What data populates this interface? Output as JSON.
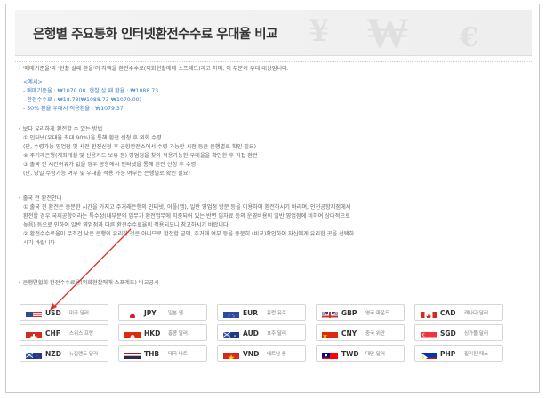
{
  "header": {
    "title": "은행별 주요통화 인터넷환전수수료 우대율 비교"
  },
  "intro": {
    "line1": "'매매기준율'과 '현찰 살때 환율'의 차액을 환전수수료(외화현찰매매 스프레드)라고 하며, 이 부분이 우대 대상입니다.",
    "example_label": "<예시>",
    "ex1": "- 매매기준율 : ₩1070.00, 현찰 살 때 환율 : ₩1088.73",
    "ex2": "- 환전수수료 : ₩18.73(₩1088.73-₩1070.00)",
    "ex3": "- 50% 환율 우대시 적용환율 : ₩1079.37"
  },
  "method": {
    "title": "보다 유리하게 환전할 수 있는 방법",
    "l1": "① 인터넷(우대율 최대 90%)을 통해 환전 신청 후 외화 수령",
    "l2": "(단, 수령가능 영업점 및 사전 환전신청 후 공항환전소에서 수령 가능한 시점 등은 은행별로 확인 필요)",
    "l3": "② 주거래은행(계좌개설 및 신용카드 보유 등) 영업점을 찾아 적용가능한 우대율을 확인한 후 직접 환전",
    "l4": "③ 출국 전 시간여유가 없을 경우 공항에서 인터넷을 통해 환전 신청 후 수령",
    "l5": "(단, 당일 수령가능 여부 및 우대율 적용 가능 여부는 은행별로 확인 필요)"
  },
  "notice": {
    "title": "출국 전 환전안내",
    "l1": "① 출국 전 환전은 충분한 시간을 가지고 주거래은행의 인터넷, 어플(앱), 일반 영업점 방문 등을 이용하여 환전하시기 바라며, 인천공항지점에서",
    "l2": "환전할 경우 국제공항이라는 특수성(대부분의 업무가 환전업무에 치중되어 있는 반면 임차료 등의 운영비용이 일반 영업점에 비하여 상대적으로",
    "l3": "높음) 등으로 인하여 일반 영업점과 다른 환전수수료율이 적용되오니 참고하시기 바랍니다",
    "l4": "② 환전수수료율이 무조건 낮은 은행이 유리한 것은 아니므로 환전할 금액, 주거래 여부 등을 충분히 (비교)확인하여 자신에게 유리한 곳을 선택하",
    "l5": "시기 바랍니다"
  },
  "compare_title": "은행연합회 환전수수료율(외화현찰매매 스프레드) 비교공시",
  "currencies": [
    {
      "code": "USD",
      "name": "미국 달러",
      "flag": "us"
    },
    {
      "code": "JPY",
      "name": "일본 엔",
      "flag": "jp"
    },
    {
      "code": "EUR",
      "name": "유럽 유로",
      "flag": "eu"
    },
    {
      "code": "GBP",
      "name": "영국 파운드",
      "flag": "gb"
    },
    {
      "code": "CAD",
      "name": "캐나다 달러",
      "flag": "ca"
    },
    {
      "code": "CHF",
      "name": "스위스 프랑",
      "flag": "ch"
    },
    {
      "code": "HKD",
      "name": "홍콩 달러",
      "flag": "hk"
    },
    {
      "code": "AUD",
      "name": "호주 달러",
      "flag": "au"
    },
    {
      "code": "CNY",
      "name": "중국 위안",
      "flag": "cn"
    },
    {
      "code": "SGD",
      "name": "싱가폴 달러",
      "flag": "sg"
    },
    {
      "code": "NZD",
      "name": "뉴질랜드 달러",
      "flag": "nz"
    },
    {
      "code": "THB",
      "name": "태국 바트",
      "flag": "th"
    },
    {
      "code": "VND",
      "name": "베트남 동",
      "flag": "vn"
    },
    {
      "code": "TWD",
      "name": "대만 달러",
      "flag": "tw"
    },
    {
      "code": "PHP",
      "name": "필리핀 페소",
      "flag": "ph"
    }
  ],
  "colors": {
    "accent_blue": "#3a7bc8",
    "arrow_red": "#e03030"
  }
}
